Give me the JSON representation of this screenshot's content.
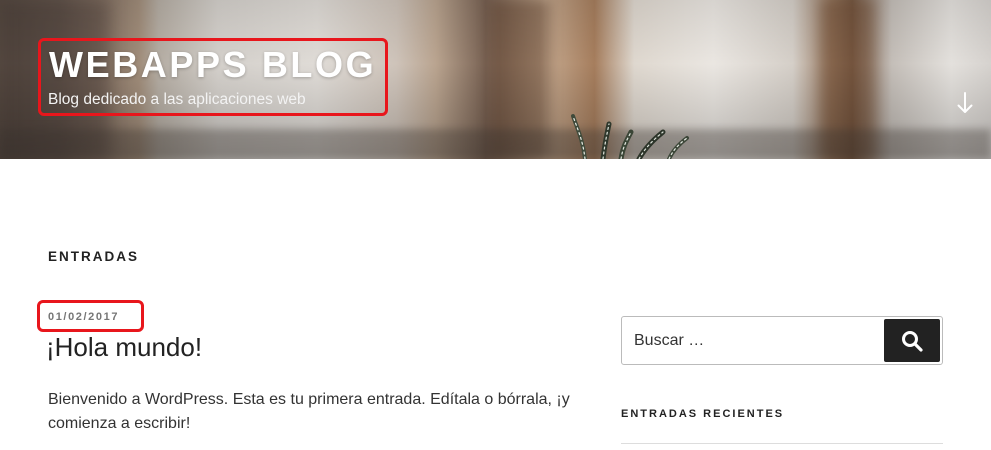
{
  "header": {
    "site_title": "WEBAPPS BLOG",
    "site_description": "Blog dedicado a las aplicaciones web",
    "scroll_icon": "arrow-down-icon",
    "highlight_color": "#e8161c"
  },
  "main": {
    "page_heading": "ENTRADAS",
    "post": {
      "date": "01/02/2017",
      "title": "¡Hola mundo!",
      "excerpt": "Bienvenido a WordPress. Esta es tu primera entrada. Edítala o bórrala, ¡y comienza a escribir!"
    }
  },
  "sidebar": {
    "search": {
      "placeholder": "Buscar …",
      "button_icon": "search-icon",
      "button_color": "#222222"
    },
    "recent_posts_title": "ENTRADAS RECIENTES"
  }
}
